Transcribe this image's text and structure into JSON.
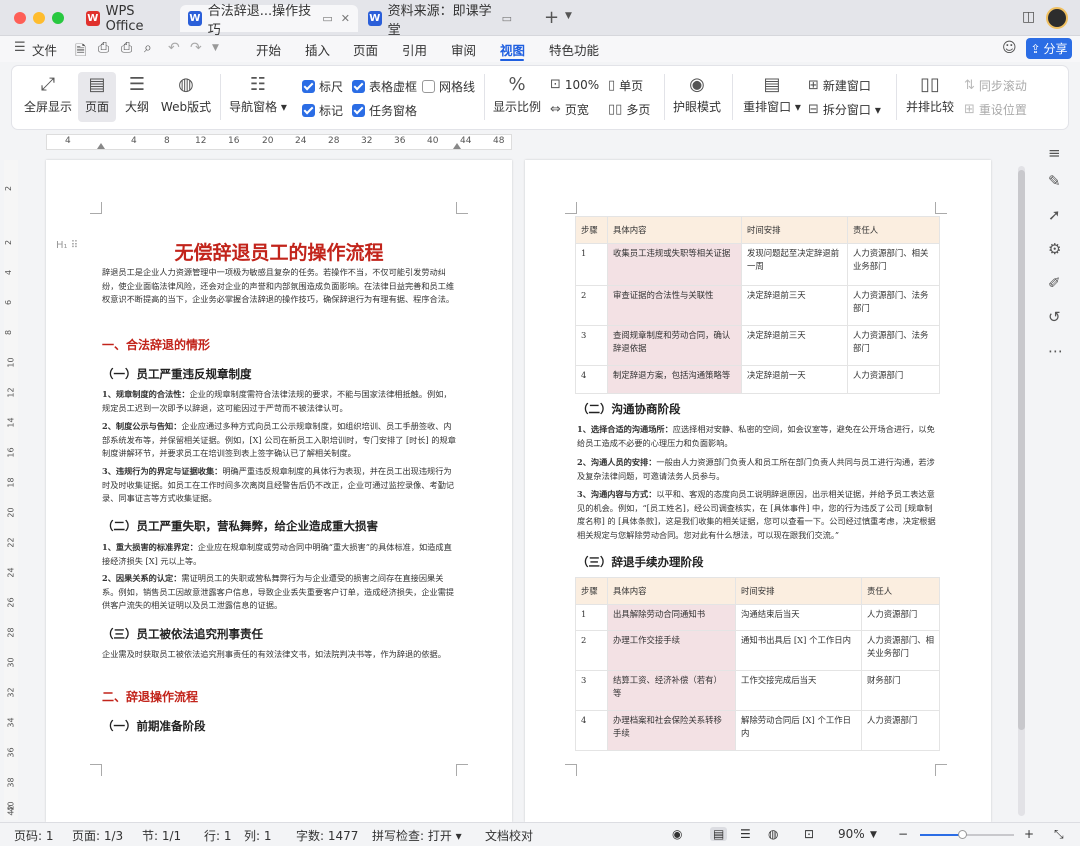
{
  "tabs": {
    "app_tab": "WPS Office",
    "doc_tab": "合法辞退...操作技巧",
    "doc_tab2": "资料来源：即课学堂",
    "new_tab": "+"
  },
  "menu": {
    "file": "文件",
    "items": [
      "开始",
      "插入",
      "页面",
      "引用",
      "审阅",
      "视图",
      "特色功能"
    ],
    "active": "视图",
    "share": "分享"
  },
  "ribbon": {
    "fullscreen": "全屏显示",
    "page": "页面",
    "outline": "大纲",
    "web": "Web版式",
    "nav_pane": "导航窗格",
    "ruler": "标尺",
    "table_gridlines": "表格虚框",
    "gridlines": "网格线",
    "mark": "标记",
    "task_pane": "任务窗格",
    "zoom": "显示比例",
    "zoom100": "100%",
    "page_width": "页宽",
    "single_page": "单页",
    "multi_page": "多页",
    "eye_mode": "护眼模式",
    "rearrange": "重排窗口",
    "new_window": "新建窗口",
    "split_window": "拆分窗口",
    "side_by_side": "并排比较",
    "sync_scroll": "同步滚动",
    "reset_pos": "重设位置"
  },
  "ruler_ticks": [
    "4",
    "4",
    "8",
    "12",
    "16",
    "20",
    "24",
    "28",
    "32",
    "36",
    "40",
    "44",
    "48"
  ],
  "vruler_ticks": [
    "2",
    "2",
    "4",
    "6",
    "8",
    "10",
    "12",
    "14",
    "16",
    "18",
    "20",
    "22",
    "24",
    "26",
    "28",
    "30",
    "32",
    "34",
    "36",
    "38",
    "40",
    "42"
  ],
  "left_page": {
    "title": "无偿辞退员工的操作流程",
    "intro": "辞退员工是企业人力资源管理中一项极为敏感且复杂的任务。若操作不当，不仅可能引发劳动纠纷，使企业面临法律风险，还会对企业的声誉和内部氛围造成负面影响。在法律日益完善和员工维权意识不断提高的当下，企业务必掌握合法辞退的操作技巧，确保辞退行为有理有据、程序合法。",
    "sec1": "一、合法辞退的情形",
    "sub1": "（一）员工严重违反规章制度",
    "p1a_lead": "1、规章制度的合法性：",
    "p1a": "企业的规章制度需符合法律法规的要求，不能与国家法律相抵触。例如，规定员工迟到一次即予以辞退，这可能因过于严苛而不被法律认可。",
    "p1b_lead": "2、制度公示与告知：",
    "p1b": "企业应通过多种方式向员工公示规章制度，如组织培训、员工手册签收、内部系统发布等，并保留相关证据。例如，[X] 公司在新员工入职培训时，专门安排了 [时长] 的规章制度讲解环节，并要求员工在培训签到表上签字确认已了解相关制度。",
    "p1c_lead": "3、违规行为的界定与证据收集：",
    "p1c": "明确严重违反规章制度的具体行为表现，并在员工出现违规行为时及时收集证据。如员工在工作时间多次离岗且经警告后仍不改正，企业可通过监控录像、考勤记录、同事证言等方式收集证据。",
    "sub2": "（二）员工严重失职，营私舞弊，给企业造成重大损害",
    "p2a_lead": "1、重大损害的标准界定：",
    "p2a": "企业应在规章制度或劳动合同中明确“重大损害”的具体标准，如造成直接经济损失 [X] 元以上等。",
    "p2b_lead": "2、因果关系的认定：",
    "p2b": "需证明员工的失职或营私舞弊行为与企业遭受的损害之间存在直接因果关系。例如，销售员工因故意泄露客户信息，导致企业丢失重要客户订单，造成经济损失，企业需提供客户流失的相关证明以及员工泄露信息的证据。",
    "sub3": "（三）员工被依法追究刑事责任",
    "p3": "企业需及时获取员工被依法追究刑事责任的有效法律文书，如法院判决书等，作为辞退的依据。",
    "sec2": "二、辞退操作流程",
    "sub4": "（一）前期准备阶段"
  },
  "right_page": {
    "table1": {
      "headers": [
        "步骤",
        "具体内容",
        "时间安排",
        "责任人"
      ],
      "rows": [
        [
          "1",
          "收集员工违规或失职等相关证据",
          "发现问题起至决定辞退前一周",
          "人力资源部门、相关业务部门"
        ],
        [
          "2",
          "审查证据的合法性与关联性",
          "决定辞退前三天",
          "人力资源部门、法务部门"
        ],
        [
          "3",
          "查阅规章制度和劳动合同，确认辞退依据",
          "决定辞退前三天",
          "人力资源部门、法务部门"
        ],
        [
          "4",
          "制定辞退方案，包括沟通策略等",
          "决定辞退前一天",
          "人力资源部门"
        ]
      ]
    },
    "sub_comm": "（二）沟通协商阶段",
    "c1_lead": "1、选择合适的沟通场所：",
    "c1": "应选择相对安静、私密的空间，如会议室等，避免在公开场合进行，以免给员工造成不必要的心理压力和负面影响。",
    "c2_lead": "2、沟通人员的安排：",
    "c2": "一般由人力资源部门负责人和员工所在部门负责人共同与员工进行沟通，若涉及复杂法律问题，可邀请法务人员参与。",
    "c3_lead": "3、沟通内容与方式：",
    "c3": "以平和、客观的态度向员工说明辞退原因，出示相关证据，并给予员工表达意见的机会。例如，“[员工姓名]，经公司调查核实，在 [具体事件] 中，您的行为违反了公司 [规章制度名称] 的 [具体条款]，这是我们收集的相关证据，您可以查看一下。公司经过慎重考虑，决定根据相关规定与您解除劳动合同。您对此有什么想法，可以现在跟我们交流。”",
    "sub_proc": "（三）辞退手续办理阶段",
    "table2": {
      "headers": [
        "步骤",
        "具体内容",
        "时间安排",
        "责任人"
      ],
      "rows": [
        [
          "1",
          "出具解除劳动合同通知书",
          "沟通结束后当天",
          "人力资源部门"
        ],
        [
          "2",
          "办理工作交接手续",
          "通知书出具后 [X] 个工作日内",
          "人力资源部门、相关业务部门"
        ],
        [
          "3",
          "结算工资、经济补偿（若有）等",
          "工作交接完成后当天",
          "财务部门"
        ],
        [
          "4",
          "办理档案和社会保险关系转移手续",
          "解除劳动合同后 [X] 个工作日内",
          "人力资源部门"
        ]
      ]
    }
  },
  "status": {
    "page_no": "页码: 1",
    "pages": "页面: 1/3",
    "section": "节: 1/1",
    "row": "行: 1",
    "col": "列: 1",
    "words": "字数: 1477",
    "spell": "拼写检查: 打开",
    "proof": "文档校对",
    "zoom": "90%"
  },
  "colors": {
    "accent": "#1f5fe0",
    "heading_red": "#c2241b",
    "table_header": "#fbeee0",
    "table_pink": "#f3e1e4"
  }
}
